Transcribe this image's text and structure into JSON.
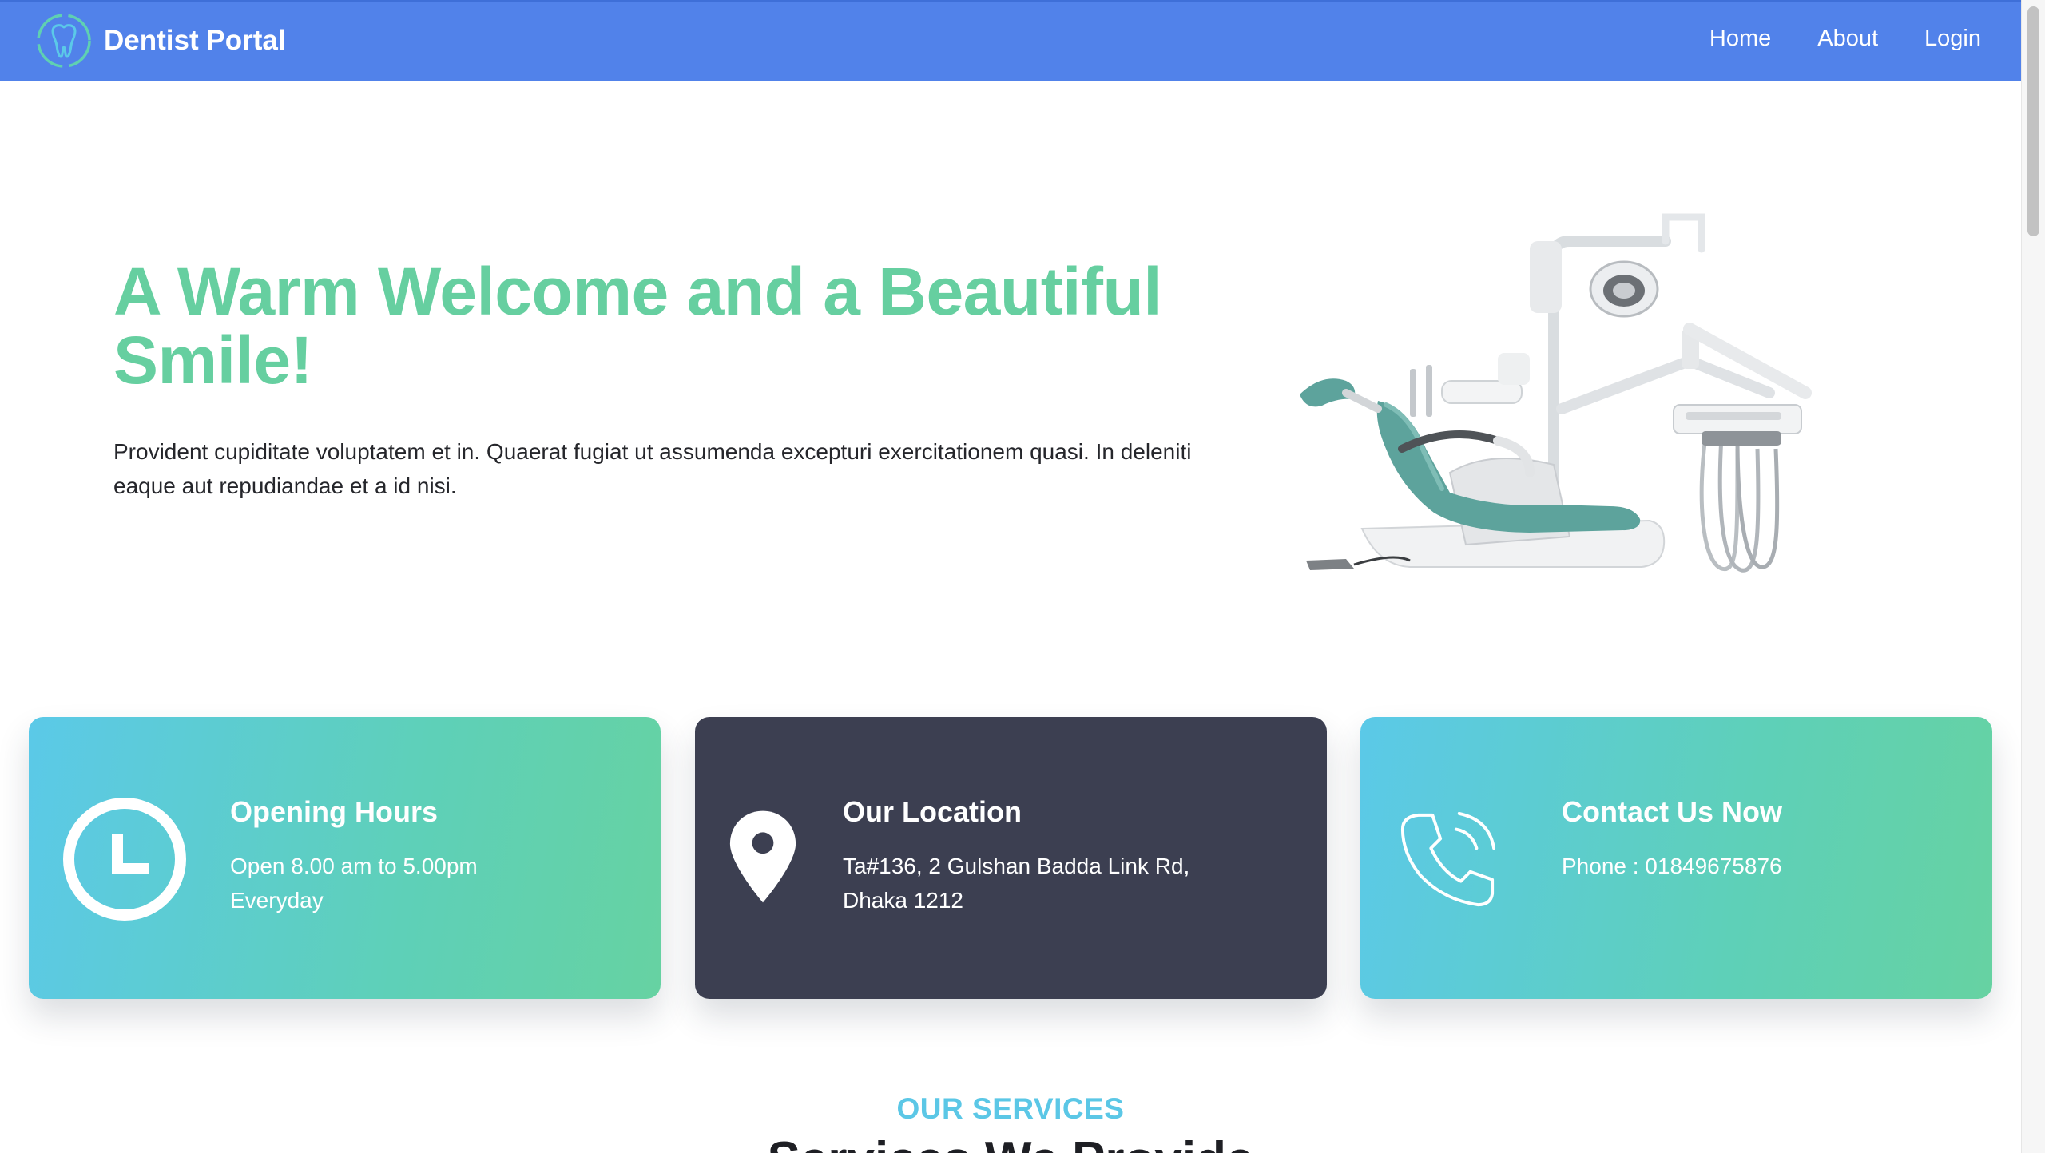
{
  "navbar": {
    "brand_name": "Dentist Portal",
    "logo_icon": "tooth-icon",
    "links": [
      {
        "label": "Home"
      },
      {
        "label": "About"
      },
      {
        "label": "Login"
      }
    ]
  },
  "hero": {
    "title": "A Warm Welcome and a Beautiful Smile!",
    "text": "Provident cupiditate voluptatem et in. Quaerat fugiat ut assumenda excepturi exercitationem quasi. In deleniti eaque aut repudiandae et a id nisi.",
    "image": "dental-chair-image"
  },
  "info_cards": [
    {
      "icon": "clock-icon",
      "title": "Opening Hours",
      "lines": [
        "Open 8.00 am to 5.00pm",
        "Everyday"
      ]
    },
    {
      "icon": "map-pin-icon",
      "title": "Our Location",
      "lines": [
        "Ta#136, 2 Gulshan Badda Link Rd,",
        "Dhaka 1212"
      ]
    },
    {
      "icon": "phone-icon",
      "title": "Contact Us Now",
      "lines": [
        "Phone : 01849675876"
      ]
    }
  ],
  "services": {
    "eyebrow": "OUR SERVICES",
    "heading": "Services We Provide"
  },
  "colors": {
    "navbar": "#5182ea",
    "hero_title": "#66cfa0",
    "card_gradient_start": "#5bc9e8",
    "card_gradient_end": "#66d2a2",
    "card_dark": "#3c3f51",
    "eyebrow": "#5bc7e6"
  }
}
